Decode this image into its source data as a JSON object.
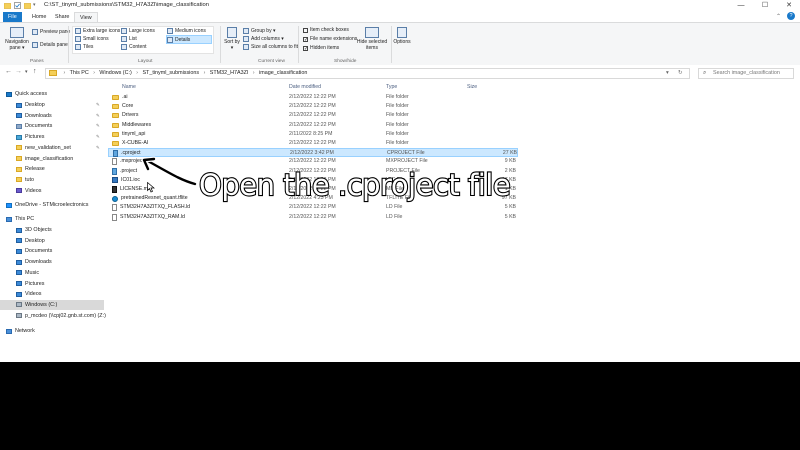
{
  "window": {
    "title": "C:\\ST_tinyml_submissions\\STM32_H7A3ZI\\image_classification",
    "controls": {
      "minimize": "—",
      "maximize": "☐",
      "close": "✕"
    }
  },
  "ribbon_tabs": [
    "File",
    "Home",
    "Share",
    "View"
  ],
  "ribbon": {
    "panes": {
      "label": "Panes",
      "navigation_pane": "Navigation pane ▾",
      "preview_pane": "Preview pane",
      "details_pane": "Details pane"
    },
    "layout": {
      "label": "Layout",
      "items": [
        "Extra large icons",
        "Large icons",
        "Medium icons",
        "Small icons",
        "List",
        "Details",
        "Tiles",
        "Content"
      ]
    },
    "current_view": {
      "label": "Current view",
      "sort_by": "Sort by ▾",
      "group_by": "Group by ▾",
      "add_columns": "Add columns ▾",
      "size_columns": "Size all columns to fit"
    },
    "show_hide": {
      "label": "Show/hide",
      "item_check_boxes": "Item check boxes",
      "file_name_extensions": "File name extensions",
      "hidden_items": "Hidden items",
      "hide_selected": "Hide selected items",
      "options": "Options"
    }
  },
  "address": {
    "crumbs": [
      "This PC",
      "Windows (C:)",
      "ST_tinyml_submissions",
      "STM32_H7A3ZI",
      "image_classification"
    ],
    "search_placeholder": "Search image_classification"
  },
  "nav": {
    "quick_access": "Quick access",
    "quick_items": [
      "Desktop",
      "Downloads",
      "Documents",
      "Pictures",
      "new_validation_set",
      "image_classification",
      "Release",
      "tuto",
      "Videos"
    ],
    "onedrive": "OneDrive - STMicroelectronics",
    "this_pc": "This PC",
    "pc_items": [
      "3D Objects",
      "Desktop",
      "Documents",
      "Downloads",
      "Music",
      "Pictures",
      "Videos",
      "Windows (C:)",
      "p_mcdeo (\\\\cpj02.gnb.st.com) (Z:)"
    ],
    "network": "Network"
  },
  "columns": {
    "name": "Name",
    "date": "Date modified",
    "type": "Type",
    "size": "Size"
  },
  "files": [
    {
      "name": ".ai",
      "date": "2/12/2022 12:22 PM",
      "type": "File folder",
      "size": "",
      "icon": "folder"
    },
    {
      "name": "Core",
      "date": "2/12/2022 12:22 PM",
      "type": "File folder",
      "size": "",
      "icon": "folder"
    },
    {
      "name": "Drivers",
      "date": "2/12/2022 12:22 PM",
      "type": "File folder",
      "size": "",
      "icon": "folder"
    },
    {
      "name": "Middlewares",
      "date": "2/12/2022 12:22 PM",
      "type": "File folder",
      "size": "",
      "icon": "folder"
    },
    {
      "name": "tinyml_api",
      "date": "2/11/2022 8:25 PM",
      "type": "File folder",
      "size": "",
      "icon": "folder"
    },
    {
      "name": "X-CUBE-AI",
      "date": "2/12/2022 12:22 PM",
      "type": "File folder",
      "size": "",
      "icon": "folder"
    },
    {
      "name": ".cproject",
      "date": "2/12/2022 3:42 PM",
      "type": "CPROJECT File",
      "size": "27 KB",
      "icon": "cproject",
      "selected": true
    },
    {
      "name": ".mxproject",
      "date": "2/12/2022 12:22 PM",
      "type": "MXPROJECT File",
      "size": "9 KB",
      "icon": "file"
    },
    {
      "name": ".project",
      "date": "2/12/2022 12:22 PM",
      "type": "PROJECT File",
      "size": "2 KB",
      "icon": "cproject"
    },
    {
      "name": "IC01.ioc",
      "date": "2/12/2022 12:22 PM",
      "type": "IOC File",
      "size": "17 KB",
      "icon": "mx"
    },
    {
      "name": "LICENSE.md",
      "date": "2/12/2022 12:22 PM",
      "type": "MD File",
      "size": "1 KB",
      "icon": "md"
    },
    {
      "name": "pretrainedResnet_quant.tflite",
      "date": "2/12/2022 4:23 PM",
      "type": "TFLITE File",
      "size": "97 KB",
      "icon": "tfl"
    },
    {
      "name": "STM32H7A3ZITXQ_FLASH.ld",
      "date": "2/12/2022 12:22 PM",
      "type": "LD File",
      "size": "5 KB",
      "icon": "file"
    },
    {
      "name": "STM32H7A3ZITXQ_RAM.ld",
      "date": "2/12/2022 12:22 PM",
      "type": "LD File",
      "size": "5 KB",
      "icon": "file"
    }
  ],
  "annotation": "Open the .cproject file"
}
